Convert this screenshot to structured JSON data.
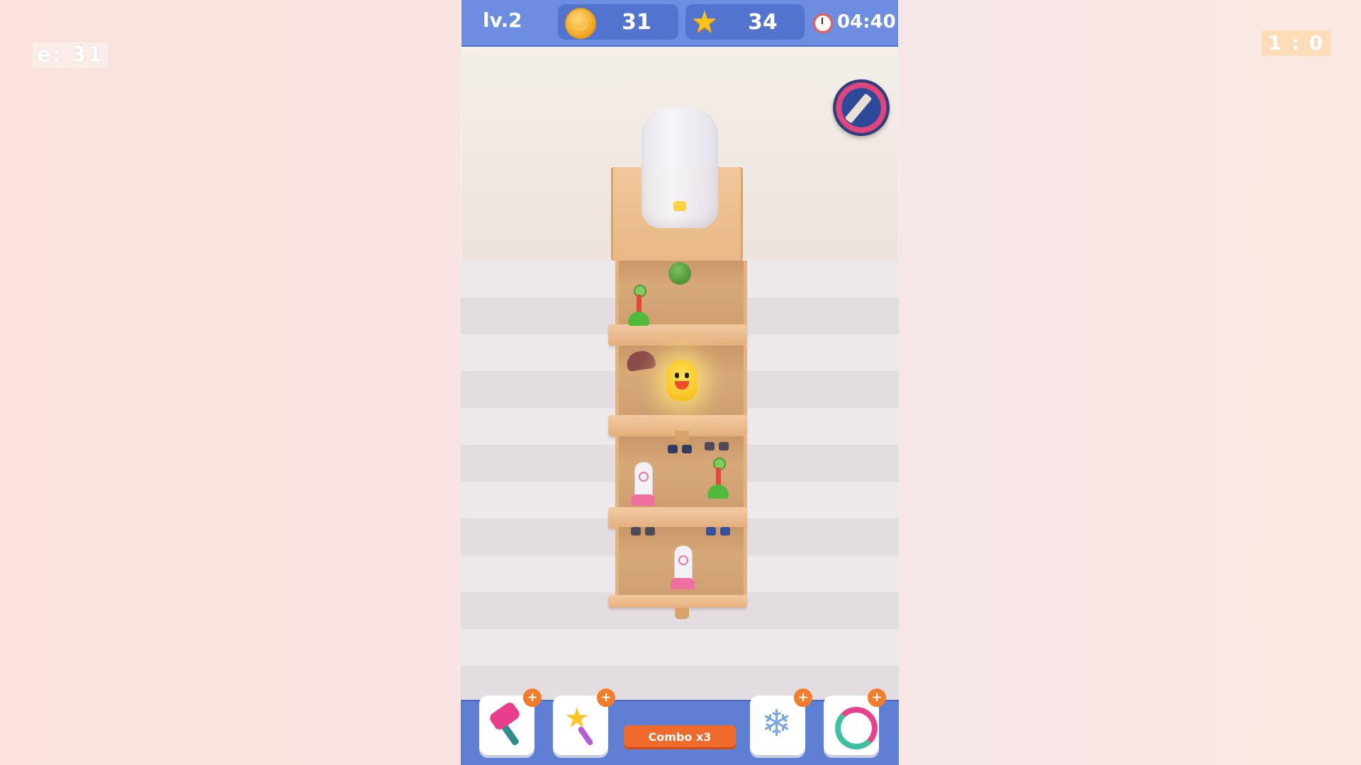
{
  "overlay": {
    "left_text": "e: 31",
    "right_text": "1 : 0"
  },
  "hud": {
    "level": "lv.2",
    "coins": "31",
    "stars": "34",
    "timer": "04:40"
  },
  "tools": [
    {
      "icon": "hammer-icon",
      "badge": "+"
    },
    {
      "icon": "magic-wand-icon",
      "badge": "+"
    },
    {
      "icon": "snowflake-icon",
      "badge": "+"
    },
    {
      "icon": "shuffle-icon",
      "badge": "+"
    }
  ],
  "combo_label": "Combo x3",
  "glyphs": {
    "star": "★",
    "snowflake": "❄"
  },
  "colors": {
    "hud_bar": "#6d8ee0",
    "bottom_bar": "#5e7fd3",
    "cabinet": "#e8b784",
    "combo": "#f06a2c"
  }
}
